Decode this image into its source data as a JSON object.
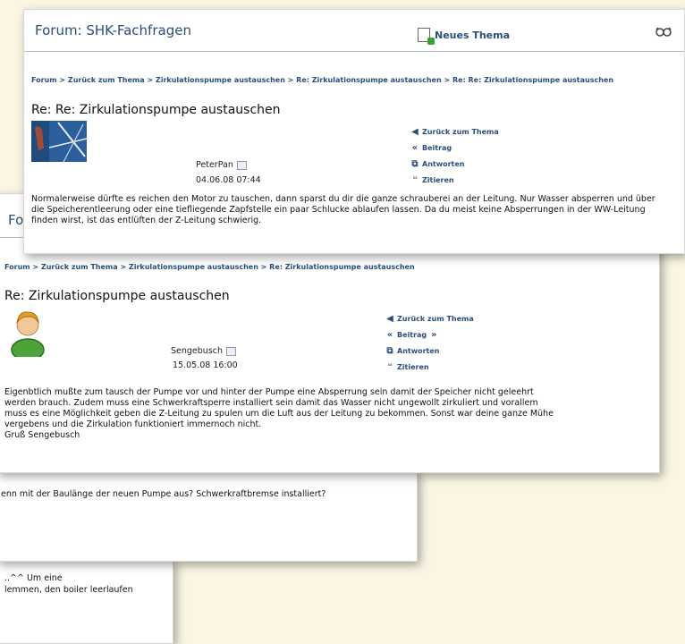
{
  "card_front": {
    "forum_title": "Forum: SHK-Fachfragen",
    "new_topic_label": "Neues Thema",
    "breadcrumb": "Forum > Zurück zum Thema > Zirkulationspumpe austauschen > Re: Zirkulationspumpe austauschen > Re: Re: Zirkulationspumpe austauschen",
    "post_title": "Re: Re: Zirkulationspumpe austauschen",
    "author": "PeterPan",
    "date": "04.06.08 07:44",
    "actions": {
      "back": "Zurück zum Thema",
      "post": "Beitrag",
      "reply": "Antworten",
      "quote": "Zitieren"
    },
    "body": "Normalerweise dürfte es reichen den Motor zu tauschen, dann sparst du dir die ganze schrauberei an der Leitung. Nur Wasser absperren und über die Speicherentleerung oder eine tiefliegende Zapfstelle ein paar Schlucke ablaufen lassen. Da du meist keine Absperrungen in der WW-Leitung finden wirst, ist das entlüften der Z-Leitung schwierig."
  },
  "card_middle": {
    "forum_title_partial": "Fo",
    "breadcrumb": "Forum > Zurück zum Thema > Zirkulationspumpe austauschen > Re: Zirkulationspumpe austauschen",
    "post_title": "Re: Zirkulationspumpe austauschen",
    "author": "Sengebusch",
    "date": "15.05.08 16:00",
    "actions": {
      "back": "Zurück zum Thema",
      "post": "Beitrag",
      "reply": "Antworten",
      "quote": "Zitieren"
    },
    "body_lines": [
      "Eigenbtlich mußte zum tausch der Pumpe vor und hinter der Pumpe eine Absperrung sein damit der Speicher nicht geleehrt",
      "werden brauch. Zudem muss eine Schwerkraftsperre installiert sein damit das Wasser nicht ungewollt zirkuliert und vorallem",
      "muss es eine Möglichkeit geben die Z-Leitung zu spulen um die Luft aus der Leitung zu bekommen. Sonst war deine ganze Mühe",
      "vergebens und die Zirkulation funktioniert immernoch nicht.",
      "Gruß Sengebusch"
    ]
  },
  "card_back": {
    "line1": "enn mit der Baulänge der neuen Pumpe aus? Schwerkraftbremse installiert?"
  },
  "card_last": {
    "line1": "..^^ Um eine",
    "line2": "lemmen, den boiler leerlaufen"
  }
}
